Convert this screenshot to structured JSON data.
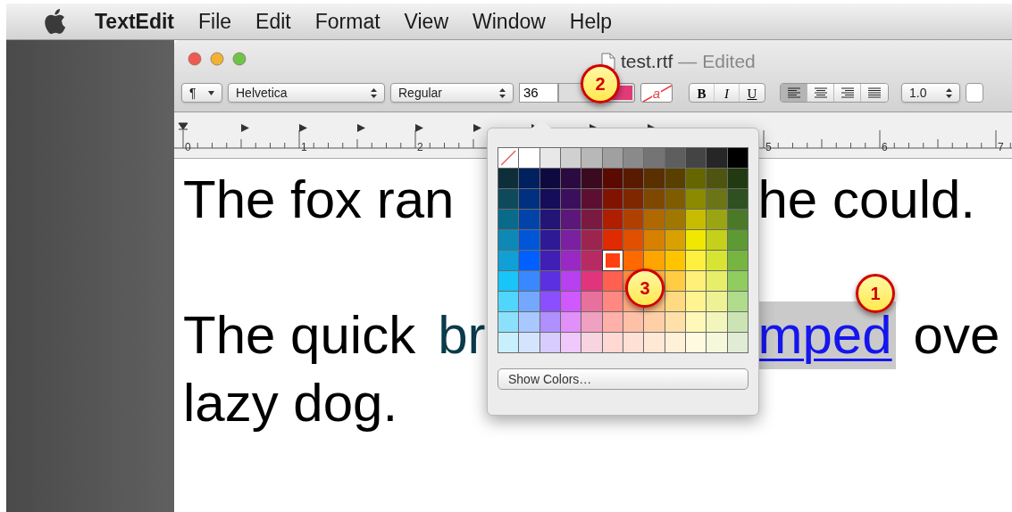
{
  "menu_bar": {
    "items": [
      {
        "label": "TextEdit",
        "kind": "app"
      },
      {
        "label": "File",
        "kind": "menu"
      },
      {
        "label": "Edit",
        "kind": "menu"
      },
      {
        "label": "Format",
        "kind": "menu"
      },
      {
        "label": "View",
        "kind": "menu"
      },
      {
        "label": "Window",
        "kind": "menu"
      },
      {
        "label": "Help",
        "kind": "menu"
      }
    ]
  },
  "window": {
    "title": "test.rtf",
    "status": "— Edited"
  },
  "toolbar": {
    "paragraph": "¶",
    "font": "Helvetica",
    "style": "Regular",
    "size": "36",
    "text_color_well": {
      "color": "#e03a78"
    },
    "background_letter": "a",
    "format_buttons": [
      {
        "label": "B",
        "kind": "bold"
      },
      {
        "label": "I",
        "kind": "italic"
      },
      {
        "label": "U",
        "kind": "underline"
      }
    ],
    "alignment": [
      {
        "kind": "left",
        "selected": true
      },
      {
        "kind": "center",
        "selected": false
      },
      {
        "kind": "right",
        "selected": false
      },
      {
        "kind": "justify",
        "selected": false
      }
    ],
    "spacing": "1.0"
  },
  "ruler": {
    "labels": [
      {
        "text": "0"
      },
      {
        "text": "1"
      },
      {
        "text": "2"
      },
      {
        "text": "5"
      },
      {
        "text": "6"
      },
      {
        "text": "7"
      }
    ]
  },
  "document": {
    "lines": [
      [
        {
          "text": "The fox ran",
          "kind": "plain"
        },
        {
          "text": "he could.",
          "kind": "plain"
        }
      ],
      [
        {
          "text": "The quick",
          "kind": "plain"
        },
        {
          "text": "br",
          "kind": "colored"
        },
        {
          "text": "mped",
          "kind": "link",
          "selected": true
        },
        {
          "text": "ove",
          "kind": "plain"
        }
      ],
      [
        {
          "text": "lazy dog.",
          "kind": "plain"
        }
      ]
    ]
  },
  "color_popover": {
    "button": "Show Colors…",
    "swatches": [
      [
        {
          "kind": "none",
          "selected": false
        },
        {
          "color": "#ffffff",
          "selected": false
        },
        {
          "color": "#e8e8e8",
          "selected": false
        },
        {
          "color": "#d0d0d0",
          "selected": false
        },
        {
          "color": "#b8b8b8",
          "selected": false
        },
        {
          "color": "#a0a0a0",
          "selected": false
        },
        {
          "color": "#8a8a8a",
          "selected": false
        },
        {
          "color": "#747474",
          "selected": false
        },
        {
          "color": "#5e5e5e",
          "selected": false
        },
        {
          "color": "#444444",
          "selected": false
        },
        {
          "color": "#262626",
          "selected": false
        },
        {
          "color": "#000000",
          "selected": false
        }
      ],
      [
        {
          "color": "#0e2f3a",
          "selected": false
        },
        {
          "color": "#002060",
          "selected": false
        },
        {
          "color": "#0e0a40",
          "selected": false
        },
        {
          "color": "#2a0a40",
          "selected": false
        },
        {
          "color": "#3a0a20",
          "selected": false
        },
        {
          "color": "#5a0a00",
          "selected": false
        },
        {
          "color": "#5a1a00",
          "selected": false
        },
        {
          "color": "#5a3000",
          "selected": false
        },
        {
          "color": "#5a4000",
          "selected": false
        },
        {
          "color": "#666600",
          "selected": false
        },
        {
          "color": "#4f5510",
          "selected": false
        },
        {
          "color": "#223a12",
          "selected": false
        }
      ],
      [
        {
          "color": "#0f4a5c",
          "selected": false
        },
        {
          "color": "#00307f",
          "selected": false
        },
        {
          "color": "#150d5a",
          "selected": false
        },
        {
          "color": "#3c0f5c",
          "selected": false
        },
        {
          "color": "#5c0f30",
          "selected": false
        },
        {
          "color": "#801400",
          "selected": false
        },
        {
          "color": "#7f2800",
          "selected": false
        },
        {
          "color": "#7f4800",
          "selected": false
        },
        {
          "color": "#7f5c00",
          "selected": false
        },
        {
          "color": "#8c8a00",
          "selected": false
        },
        {
          "color": "#6c7516",
          "selected": false
        },
        {
          "color": "#2f5020",
          "selected": false
        }
      ],
      [
        {
          "color": "#0a6a8a",
          "selected": false
        },
        {
          "color": "#0044aa",
          "selected": false
        },
        {
          "color": "#231575",
          "selected": false
        },
        {
          "color": "#5c177a",
          "selected": false
        },
        {
          "color": "#7a1a40",
          "selected": false
        },
        {
          "color": "#b01e00",
          "selected": false
        },
        {
          "color": "#b04000",
          "selected": false
        },
        {
          "color": "#b06800",
          "selected": false
        },
        {
          "color": "#a07800",
          "selected": false
        },
        {
          "color": "#c8bc00",
          "selected": false
        },
        {
          "color": "#9aa514",
          "selected": false
        },
        {
          "color": "#4a7a28",
          "selected": false
        }
      ],
      [
        {
          "color": "#0e88b4",
          "selected": false
        },
        {
          "color": "#0056d6",
          "selected": false
        },
        {
          "color": "#2e1a94",
          "selected": false
        },
        {
          "color": "#7a20a0",
          "selected": false
        },
        {
          "color": "#9c2550",
          "selected": false
        },
        {
          "color": "#e02a00",
          "selected": false
        },
        {
          "color": "#e05000",
          "selected": false
        },
        {
          "color": "#d88000",
          "selected": false
        },
        {
          "color": "#d8a000",
          "selected": false
        },
        {
          "color": "#f0e800",
          "selected": false
        },
        {
          "color": "#c4d01a",
          "selected": false
        },
        {
          "color": "#5e9a34",
          "selected": false
        }
      ],
      [
        {
          "color": "#10a0d6",
          "selected": false
        },
        {
          "color": "#0060ff",
          "selected": false
        },
        {
          "color": "#4020b4",
          "selected": false
        },
        {
          "color": "#9a28c4",
          "selected": false
        },
        {
          "color": "#b82a62",
          "selected": false
        },
        {
          "color": "#ff4010",
          "selected": true
        },
        {
          "color": "#ff6a00",
          "selected": false
        },
        {
          "color": "#ffa500",
          "selected": false
        },
        {
          "color": "#ffc400",
          "selected": false
        },
        {
          "color": "#fff040",
          "selected": false
        },
        {
          "color": "#d8e434",
          "selected": false
        },
        {
          "color": "#76b640",
          "selected": false
        }
      ],
      [
        {
          "color": "#18c4f8",
          "selected": false
        },
        {
          "color": "#3a88ff",
          "selected": false
        },
        {
          "color": "#5a30e0",
          "selected": false
        },
        {
          "color": "#b840f0",
          "selected": false
        },
        {
          "color": "#e0347c",
          "selected": false
        },
        {
          "color": "#ff6050",
          "selected": false
        },
        {
          "color": "#ff8a40",
          "selected": false
        },
        {
          "color": "#ffb040",
          "selected": false
        },
        {
          "color": "#ffcc44",
          "selected": false
        },
        {
          "color": "#fff07a",
          "selected": false
        },
        {
          "color": "#e6ee6a",
          "selected": false
        },
        {
          "color": "#90cc60",
          "selected": false
        }
      ],
      [
        {
          "color": "#50d6fc",
          "selected": false
        },
        {
          "color": "#74a8ff",
          "selected": false
        },
        {
          "color": "#8a50ff",
          "selected": false
        },
        {
          "color": "#d058ff",
          "selected": false
        },
        {
          "color": "#e8709c",
          "selected": false
        },
        {
          "color": "#ff8880",
          "selected": false
        },
        {
          "color": "#ffa880",
          "selected": false
        },
        {
          "color": "#ffc080",
          "selected": false
        },
        {
          "color": "#ffda80",
          "selected": false
        },
        {
          "color": "#fff490",
          "selected": false
        },
        {
          "color": "#eef294",
          "selected": false
        },
        {
          "color": "#b0dc8c",
          "selected": false
        }
      ],
      [
        {
          "color": "#8ce0fc",
          "selected": false
        },
        {
          "color": "#a8c8ff",
          "selected": false
        },
        {
          "color": "#b090ff",
          "selected": false
        },
        {
          "color": "#e090f8",
          "selected": false
        },
        {
          "color": "#f0a0c0",
          "selected": false
        },
        {
          "color": "#ffb0a8",
          "selected": false
        },
        {
          "color": "#ffc0a8",
          "selected": false
        },
        {
          "color": "#ffd0a8",
          "selected": false
        },
        {
          "color": "#ffe0a8",
          "selected": false
        },
        {
          "color": "#fff8b8",
          "selected": false
        },
        {
          "color": "#f2f6bc",
          "selected": false
        },
        {
          "color": "#cce4b4",
          "selected": false
        }
      ],
      [
        {
          "color": "#c8f0fc",
          "selected": false
        },
        {
          "color": "#d4e4ff",
          "selected": false
        },
        {
          "color": "#d8ccff",
          "selected": false
        },
        {
          "color": "#f0c8fc",
          "selected": false
        },
        {
          "color": "#f8d4e0",
          "selected": false
        },
        {
          "color": "#ffd8d4",
          "selected": false
        },
        {
          "color": "#ffe0d4",
          "selected": false
        },
        {
          "color": "#ffe8d4",
          "selected": false
        },
        {
          "color": "#fff0d8",
          "selected": false
        },
        {
          "color": "#fffae0",
          "selected": false
        },
        {
          "color": "#f6f8dc",
          "selected": false
        },
        {
          "color": "#e0ecd4",
          "selected": false
        }
      ]
    ]
  },
  "callouts": [
    {
      "number": "1"
    },
    {
      "number": "2"
    },
    {
      "number": "3"
    }
  ]
}
